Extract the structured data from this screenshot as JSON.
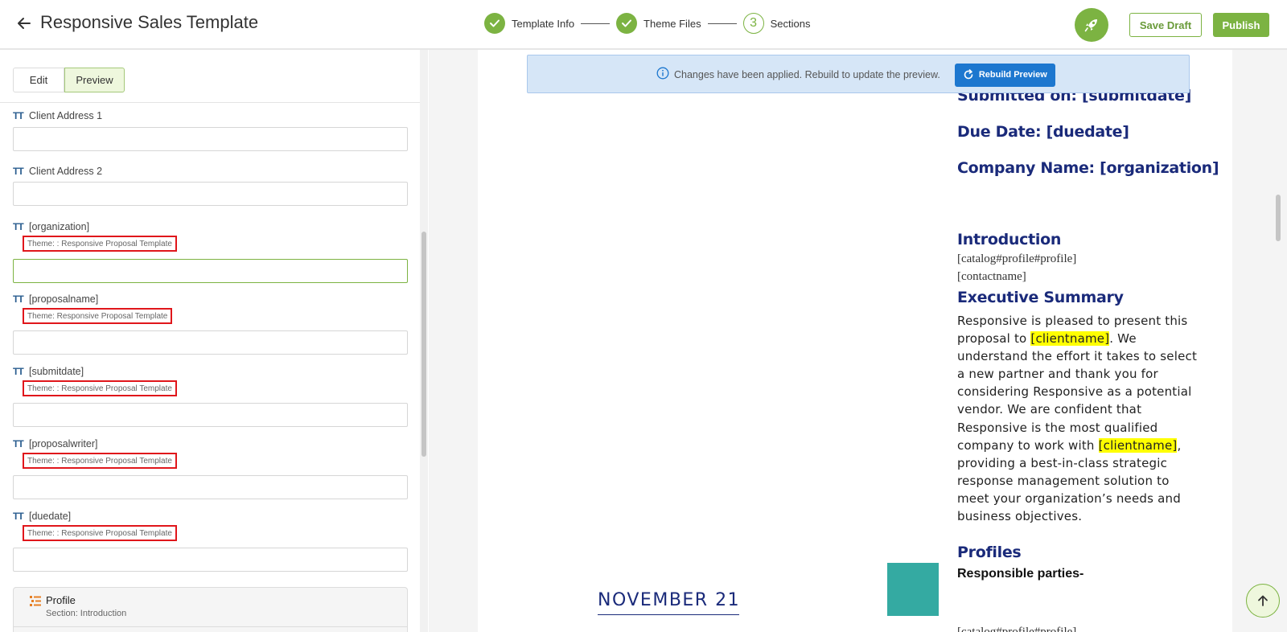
{
  "header": {
    "title": "Responsive Sales Template",
    "steps": [
      {
        "label": "Template Info",
        "state": "done"
      },
      {
        "label": "Theme Files",
        "state": "done"
      },
      {
        "number": "3",
        "label": "Sections",
        "state": "current"
      }
    ],
    "save_draft": "Save Draft",
    "publish": "Publish"
  },
  "left_panel": {
    "tabs": {
      "edit": "Edit",
      "preview": "Preview"
    },
    "fields": [
      {
        "label": "Client Address 1",
        "theme": ""
      },
      {
        "label": "Client Address 2",
        "theme": ""
      },
      {
        "label": "[organization]",
        "theme": "Theme: : Responsive Proposal Template"
      },
      {
        "label": "[proposalname]",
        "theme": "Theme: Responsive Proposal Template"
      },
      {
        "label": "[submitdate]",
        "theme": "Theme: : Responsive Proposal Template"
      },
      {
        "label": "[proposalwriter]",
        "theme": "Theme: : Responsive Proposal Template"
      },
      {
        "label": "[duedate]",
        "theme": "Theme: : Responsive Proposal Template"
      }
    ],
    "section": {
      "title": "Profile",
      "subtitle": "Section: Introduction"
    }
  },
  "notice": {
    "text": "Changes have been applied. Rebuild to update the preview.",
    "button": "Rebuild Preview"
  },
  "document": {
    "submitted_on": "Submitted on: [submitdate]",
    "due_date": "Due Date: [duedate]",
    "company_name": "Company Name: [organization]",
    "introduction_heading": "Introduction",
    "intro_line1": "[catalog#profile#profile]",
    "intro_line2": "[contactname]",
    "exec_heading": "Executive Summary",
    "exec_part1": "Responsive is pleased to present this proposal to ",
    "clientname": "[clientname]",
    "exec_part2": ". We understand the effort it takes to select a new partner and thank you for considering Responsive as a potential vendor. We are confident that Responsive is the most qualified company to work with ",
    "exec_part3": ", providing a best-in-class strategic response management solution to meet your organization’s needs and business objectives.",
    "profiles_heading": "Profiles",
    "responsible_parties": "Responsible parties-",
    "cutoff_text": "[catalog#profile#profile]",
    "cover_date": "NOVEMBER 21"
  },
  "colors": {
    "accent_green": "#7cb342",
    "heading_navy": "#1a2a7a",
    "highlight": "#ffff00",
    "teal_block": "#34aaa2",
    "tag_border": "#e0161b",
    "rebuild_blue": "#1d77cf"
  },
  "icons": [
    "back-arrow-icon",
    "check-icon",
    "rocket-icon",
    "text-type-icon",
    "info-icon",
    "refresh-icon",
    "list-icon",
    "arrow-up-icon"
  ]
}
